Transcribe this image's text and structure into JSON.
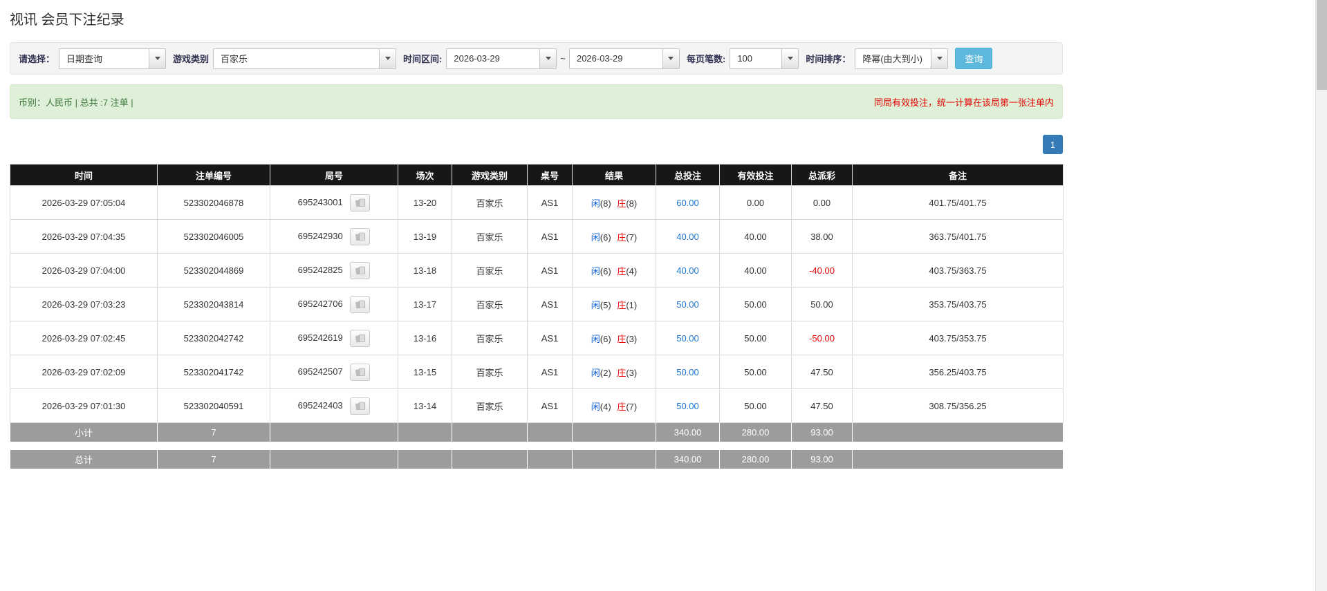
{
  "page": {
    "title": "视讯 会员下注纪录"
  },
  "colors": {
    "accent_button": "#5db8dc",
    "pagination_active": "#337ab7",
    "link_blue": "#1a73d1",
    "player_blue": "#0b5fd3",
    "banker_red": "#e60000",
    "negative_red": "#e60000",
    "notice_red": "#e60000",
    "success_text": "#3c763d",
    "success_bg": "#dff0d8",
    "header_bg": "#171717",
    "summary_bg": "#9c9c9c"
  },
  "icons": {
    "dropdown": "chevron-down-icon",
    "round_detail": "cards-icon"
  },
  "filters": {
    "select_label": "请选择：",
    "select_value": "日期查询",
    "game_label": "游戏类别",
    "game_value": "百家乐",
    "range_label": "时间区间:",
    "date_from": "2026-03-29",
    "range_separator": "~",
    "date_to": "2026-03-29",
    "page_size_label": "每页笔数:",
    "page_size_value": "100",
    "sort_label": "时间排序：",
    "sort_value": "降幂(由大到小)",
    "search_button": "查询"
  },
  "info_bar": {
    "summary": "币别：人民币 | 总共 :7 注单 |",
    "notice": "同局有效投注，统一计算在该局第一张注单内"
  },
  "pagination": {
    "current": "1"
  },
  "table": {
    "headers": [
      "时间",
      "注单编号",
      "局号",
      "场次",
      "游戏类别",
      "桌号",
      "结果",
      "总投注",
      "有效投注",
      "总派彩",
      "备注"
    ],
    "result_labels": {
      "player": "闲",
      "banker": "庄"
    },
    "rows": [
      {
        "time": "2026-03-29 07:05:04",
        "bet_id": "523302046878",
        "round_id": "695243001",
        "session": "13-20",
        "game": "百家乐",
        "table_no": "AS1",
        "player_score": "(8)",
        "banker_score": "(8)",
        "total_bet": "60.00",
        "valid_bet": "0.00",
        "payout": "0.00",
        "note": "401.75/401.75"
      },
      {
        "time": "2026-03-29 07:04:35",
        "bet_id": "523302046005",
        "round_id": "695242930",
        "session": "13-19",
        "game": "百家乐",
        "table_no": "AS1",
        "player_score": "(6)",
        "banker_score": "(7)",
        "total_bet": "40.00",
        "valid_bet": "40.00",
        "payout": "38.00",
        "note": "363.75/401.75"
      },
      {
        "time": "2026-03-29 07:04:00",
        "bet_id": "523302044869",
        "round_id": "695242825",
        "session": "13-18",
        "game": "百家乐",
        "table_no": "AS1",
        "player_score": "(6)",
        "banker_score": "(4)",
        "total_bet": "40.00",
        "valid_bet": "40.00",
        "payout": "-40.00",
        "note": "403.75/363.75"
      },
      {
        "time": "2026-03-29 07:03:23",
        "bet_id": "523302043814",
        "round_id": "695242706",
        "session": "13-17",
        "game": "百家乐",
        "table_no": "AS1",
        "player_score": "(5)",
        "banker_score": "(1)",
        "total_bet": "50.00",
        "valid_bet": "50.00",
        "payout": "50.00",
        "note": "353.75/403.75"
      },
      {
        "time": "2026-03-29 07:02:45",
        "bet_id": "523302042742",
        "round_id": "695242619",
        "session": "13-16",
        "game": "百家乐",
        "table_no": "AS1",
        "player_score": "(6)",
        "banker_score": "(3)",
        "total_bet": "50.00",
        "valid_bet": "50.00",
        "payout": "-50.00",
        "note": "403.75/353.75"
      },
      {
        "time": "2026-03-29 07:02:09",
        "bet_id": "523302041742",
        "round_id": "695242507",
        "session": "13-15",
        "game": "百家乐",
        "table_no": "AS1",
        "player_score": "(2)",
        "banker_score": "(3)",
        "total_bet": "50.00",
        "valid_bet": "50.00",
        "payout": "47.50",
        "note": "356.25/403.75"
      },
      {
        "time": "2026-03-29 07:01:30",
        "bet_id": "523302040591",
        "round_id": "695242403",
        "session": "13-14",
        "game": "百家乐",
        "table_no": "AS1",
        "player_score": "(4)",
        "banker_score": "(7)",
        "total_bet": "50.00",
        "valid_bet": "50.00",
        "payout": "47.50",
        "note": "308.75/356.25"
      }
    ],
    "subtotal": {
      "label": "小计",
      "count": "7",
      "total_bet": "340.00",
      "valid_bet": "280.00",
      "payout": "93.00"
    },
    "grand_total": {
      "label": "总计",
      "count": "7",
      "total_bet": "340.00",
      "valid_bet": "280.00",
      "payout": "93.00"
    }
  }
}
